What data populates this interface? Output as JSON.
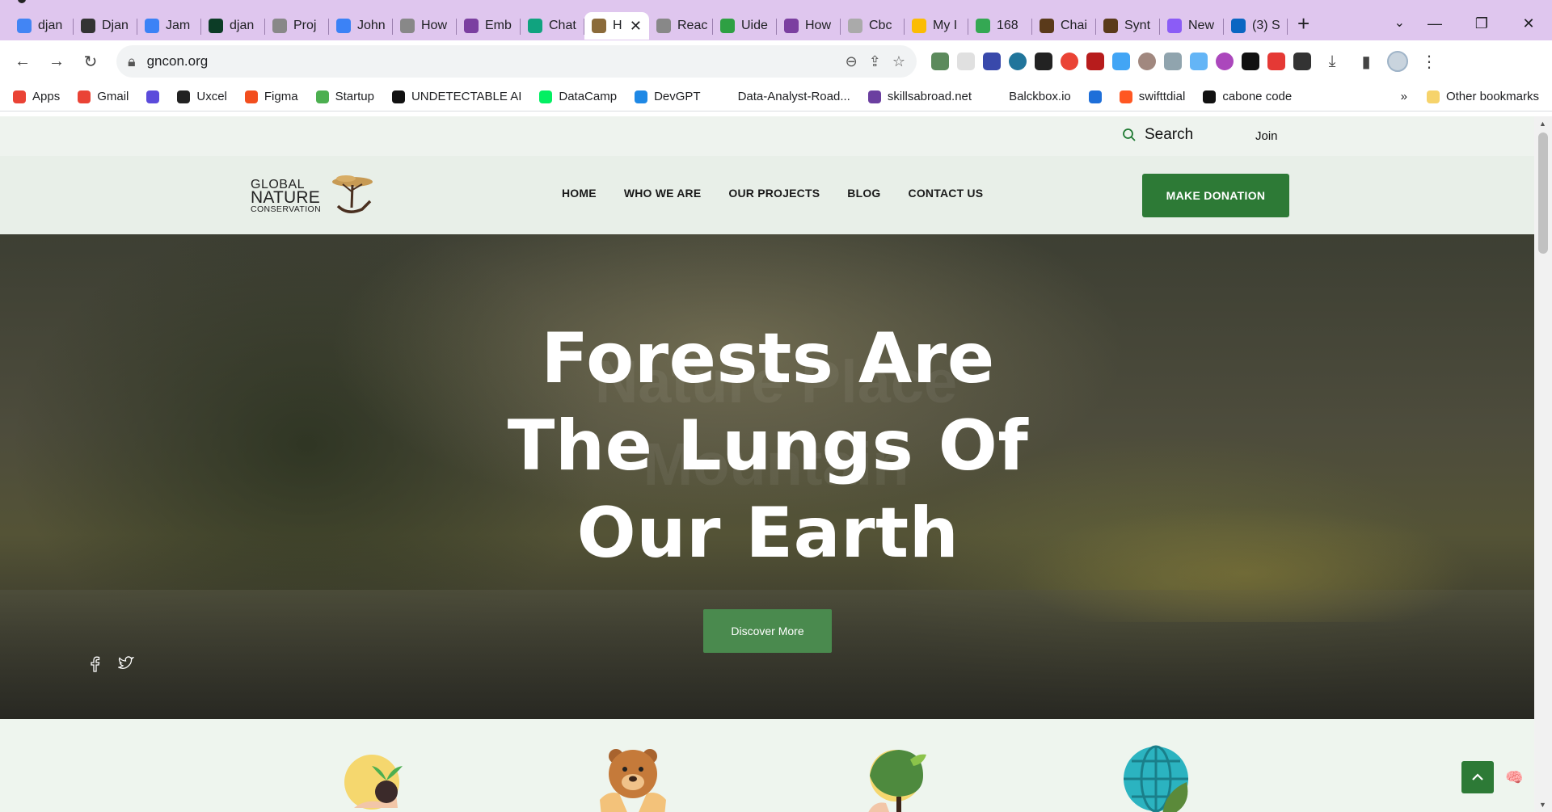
{
  "browser": {
    "tabs": [
      {
        "title": "djan",
        "icon": "google-icon",
        "color": "#4285f4"
      },
      {
        "title": "Djan",
        "icon": "github-icon",
        "color": "#333333"
      },
      {
        "title": "Jam",
        "icon": "butterfly-icon",
        "color": "#3b82f6"
      },
      {
        "title": "djan",
        "icon": "django-icon",
        "color": "#0c3c26"
      },
      {
        "title": "Proj",
        "icon": "globe-icon",
        "color": "#888888"
      },
      {
        "title": "John",
        "icon": "butterfly-icon",
        "color": "#3b82f6"
      },
      {
        "title": "How",
        "icon": "globe-icon",
        "color": "#888888"
      },
      {
        "title": "Emb",
        "icon": "square-icon",
        "color": "#7b3fa0"
      },
      {
        "title": "Chat",
        "icon": "openai-icon",
        "color": "#10a37f"
      },
      {
        "title": "H",
        "icon": "site-logo-icon",
        "color": "#8b6b3a",
        "active": true
      },
      {
        "title": "Reac",
        "icon": "globe-icon",
        "color": "#888888"
      },
      {
        "title": "Uide",
        "icon": "square-icon",
        "color": "#2ea043"
      },
      {
        "title": "How",
        "icon": "square-icon",
        "color": "#7b3fa0"
      },
      {
        "title": "Cbc",
        "icon": "github-icon",
        "color": "#aaaaaa"
      },
      {
        "title": "My I",
        "icon": "drive-icon",
        "color": "#fbbc04"
      },
      {
        "title": "168",
        "icon": "drive-icon",
        "color": "#34a853"
      },
      {
        "title": "Chai",
        "icon": "square-icon",
        "color": "#5a3a1a"
      },
      {
        "title": "Synt",
        "icon": "square-icon",
        "color": "#5a3a1a"
      },
      {
        "title": "New",
        "icon": "circle-icon",
        "color": "#8b5cf6"
      },
      {
        "title": "(3) S",
        "icon": "linkedin-icon",
        "color": "#0a66c2"
      }
    ],
    "url": "gncon.org",
    "bookmarks": [
      {
        "label": "Apps",
        "color": "#ea4335"
      },
      {
        "label": "Gmail",
        "color": "#ea4335"
      },
      {
        "label": "",
        "color": "#5b4bdb"
      },
      {
        "label": "Uxcel",
        "color": "#222222"
      },
      {
        "label": "Figma",
        "color": "#f24e1e"
      },
      {
        "label": "Startup",
        "color": "#4caf50"
      },
      {
        "label": "UNDETECTABLE AI",
        "color": "#111111"
      },
      {
        "label": "DataCamp",
        "color": "#03ef62"
      },
      {
        "label": "DevGPT",
        "color": "#1e88e5"
      },
      {
        "label": "Data-Analyst-Road...",
        "color": "#ffffff"
      },
      {
        "label": "skillsabroad.net",
        "color": "#6b3fa0"
      },
      {
        "label": "Balckbox.io",
        "color": "#ffffff"
      },
      {
        "label": "",
        "color": "#1e6fd9"
      },
      {
        "label": "swifttdial",
        "color": "#ff5722"
      },
      {
        "label": "cabone code",
        "color": "#111111"
      }
    ],
    "bookmarks_overflow": "»",
    "other_bookmarks": "Other bookmarks"
  },
  "site": {
    "search_label": "Search",
    "join_label": "Join",
    "logo": {
      "line1": "GLOBAL",
      "line2": "NATURE",
      "line3": "CONSERVATION"
    },
    "menu": [
      "HOME",
      "WHO WE ARE",
      "OUR PROJECTS",
      "BLOG",
      "CONTACT US"
    ],
    "donate_label": "MAKE DONATION",
    "hero": {
      "title_lines": [
        "Forests Are",
        "The Lungs Of",
        "Our Earth"
      ],
      "ghost_lines": [
        "Nature Place",
        "Mountain"
      ],
      "cta_label": "Discover More"
    },
    "social": [
      "facebook-icon",
      "twitter-icon"
    ],
    "features": [
      "plant-icon",
      "bear-icon",
      "tree-icon",
      "globe-icon"
    ],
    "colors": {
      "primary_green": "#2d7a36",
      "cta_green": "#4a8a4e",
      "header_bg": "#e8efe8"
    }
  }
}
